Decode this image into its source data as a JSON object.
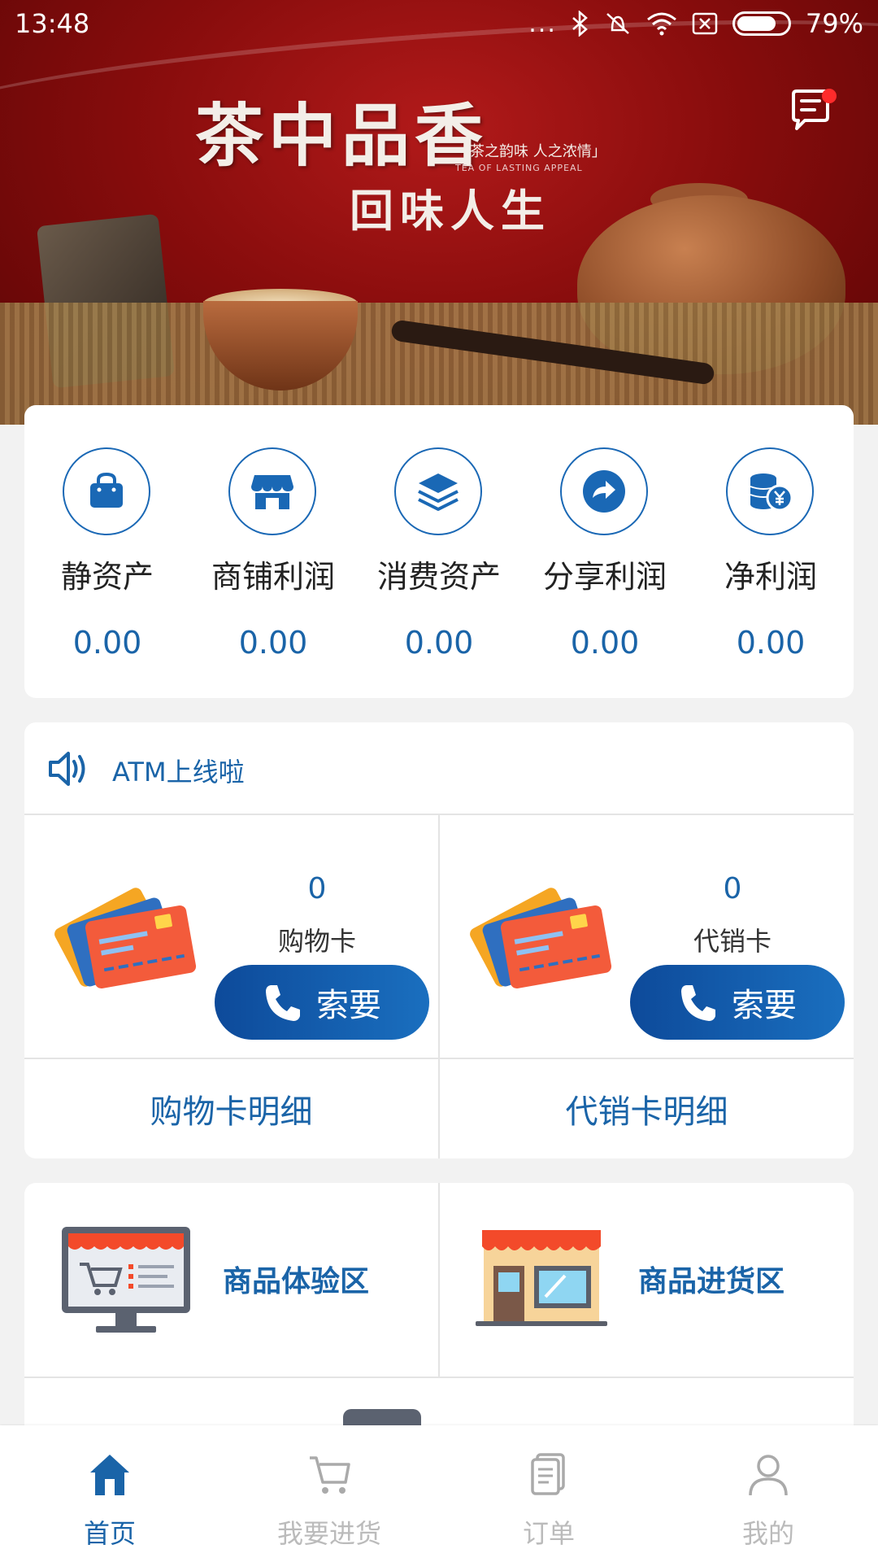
{
  "status_bar": {
    "time": "13:48",
    "dots": "...",
    "battery": "79%"
  },
  "banner": {
    "title": "茶中品香",
    "subtitle": "回味人生",
    "tag": "「茶之韵味 人之浓情」",
    "tag_en": "TEA OF LASTING APPEAL"
  },
  "assets": [
    {
      "label": "静资产",
      "value": "0.00",
      "icon": "shopping-bag-icon"
    },
    {
      "label": "商铺利润",
      "value": "0.00",
      "icon": "storefront-icon"
    },
    {
      "label": "消费资产",
      "value": "0.00",
      "icon": "layers-icon"
    },
    {
      "label": "分享利润",
      "value": "0.00",
      "icon": "share-arrow-icon"
    },
    {
      "label": "净利润",
      "value": "0.00",
      "icon": "coins-yen-icon"
    }
  ],
  "notice": {
    "text": "ATM上线啦",
    "icon": "speaker-icon"
  },
  "cards": [
    {
      "count": "0",
      "name": "购物卡",
      "button": "索要",
      "detail": "购物卡明细"
    },
    {
      "count": "0",
      "name": "代销卡",
      "button": "索要",
      "detail": "代销卡明细"
    }
  ],
  "zones": [
    {
      "label": "商品体验区",
      "icon": "monitor-cart-icon"
    },
    {
      "label": "商品进货区",
      "icon": "shop-front-icon"
    }
  ],
  "bottom_nav": [
    {
      "label": "首页",
      "icon": "home-icon",
      "active": true
    },
    {
      "label": "我要进货",
      "icon": "cart-icon",
      "active": false
    },
    {
      "label": "订单",
      "icon": "orders-icon",
      "active": false
    },
    {
      "label": "我的",
      "icon": "user-icon",
      "active": false
    }
  ],
  "colors": {
    "accent": "#1a64a8",
    "button_gradient_start": "#0d4a9a",
    "button_gradient_end": "#1a6fbf",
    "banner_red": "#8a0d0d"
  }
}
